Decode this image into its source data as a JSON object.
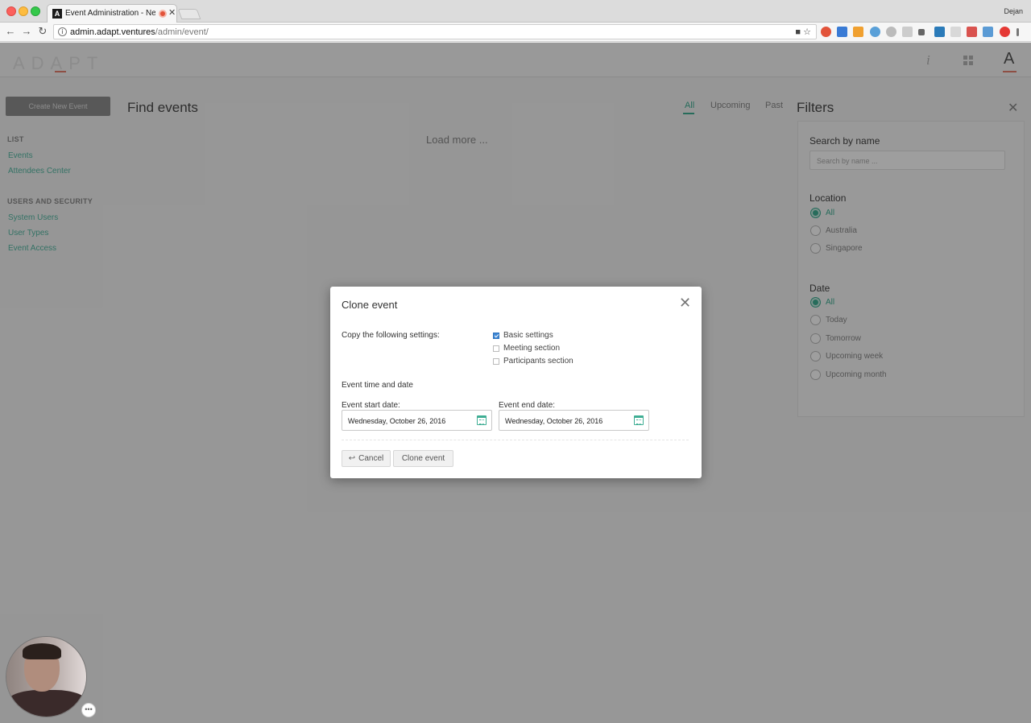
{
  "browser": {
    "tab_title": "Event Administration - Nexin",
    "tab_favicon_letter": "A",
    "profile_name": "Dejan",
    "url_host": "admin.adapt.ventures",
    "url_path": "/admin/event/"
  },
  "app": {
    "logo_text": "ADAPT",
    "avatar_letter": "A",
    "create_button": "Create New Event",
    "page_title": "Find events",
    "load_more": "Load more ...",
    "tabs": [
      {
        "label": "All",
        "active": true
      },
      {
        "label": "Upcoming",
        "active": false
      },
      {
        "label": "Past",
        "active": false
      }
    ],
    "sidebar": {
      "list_title": "LIST",
      "list_items": [
        "Events",
        "Attendees Center"
      ],
      "security_title": "USERS AND SECURITY",
      "security_items": [
        "System Users",
        "User Types",
        "Event Access"
      ]
    },
    "filters": {
      "title": "Filters",
      "search_label": "Search by name",
      "search_placeholder": "Search by name ...",
      "location_label": "Location",
      "location_options": [
        "All",
        "Australia",
        "Singapore"
      ],
      "location_selected": "All",
      "date_label": "Date",
      "date_options": [
        "All",
        "Today",
        "Tomorrow",
        "Upcoming week",
        "Upcoming month"
      ],
      "date_selected": "All"
    }
  },
  "modal": {
    "title": "Clone event",
    "copy_label": "Copy the following settings:",
    "options": [
      {
        "label": "Basic settings",
        "checked": true
      },
      {
        "label": "Meeting section",
        "checked": false
      },
      {
        "label": "Participants section",
        "checked": false
      }
    ],
    "time_section_label": "Event time and date",
    "start_label": "Event start date:",
    "start_value": "Wednesday, October 26, 2016",
    "end_label": "Event end date:",
    "end_value": "Wednesday, October 26, 2016",
    "cancel_label": "Cancel",
    "clone_label": "Clone event"
  },
  "colors": {
    "accent": "#3fae94",
    "brand_underline": "#e6806e",
    "checkbox_checked": "#3d86d4"
  }
}
